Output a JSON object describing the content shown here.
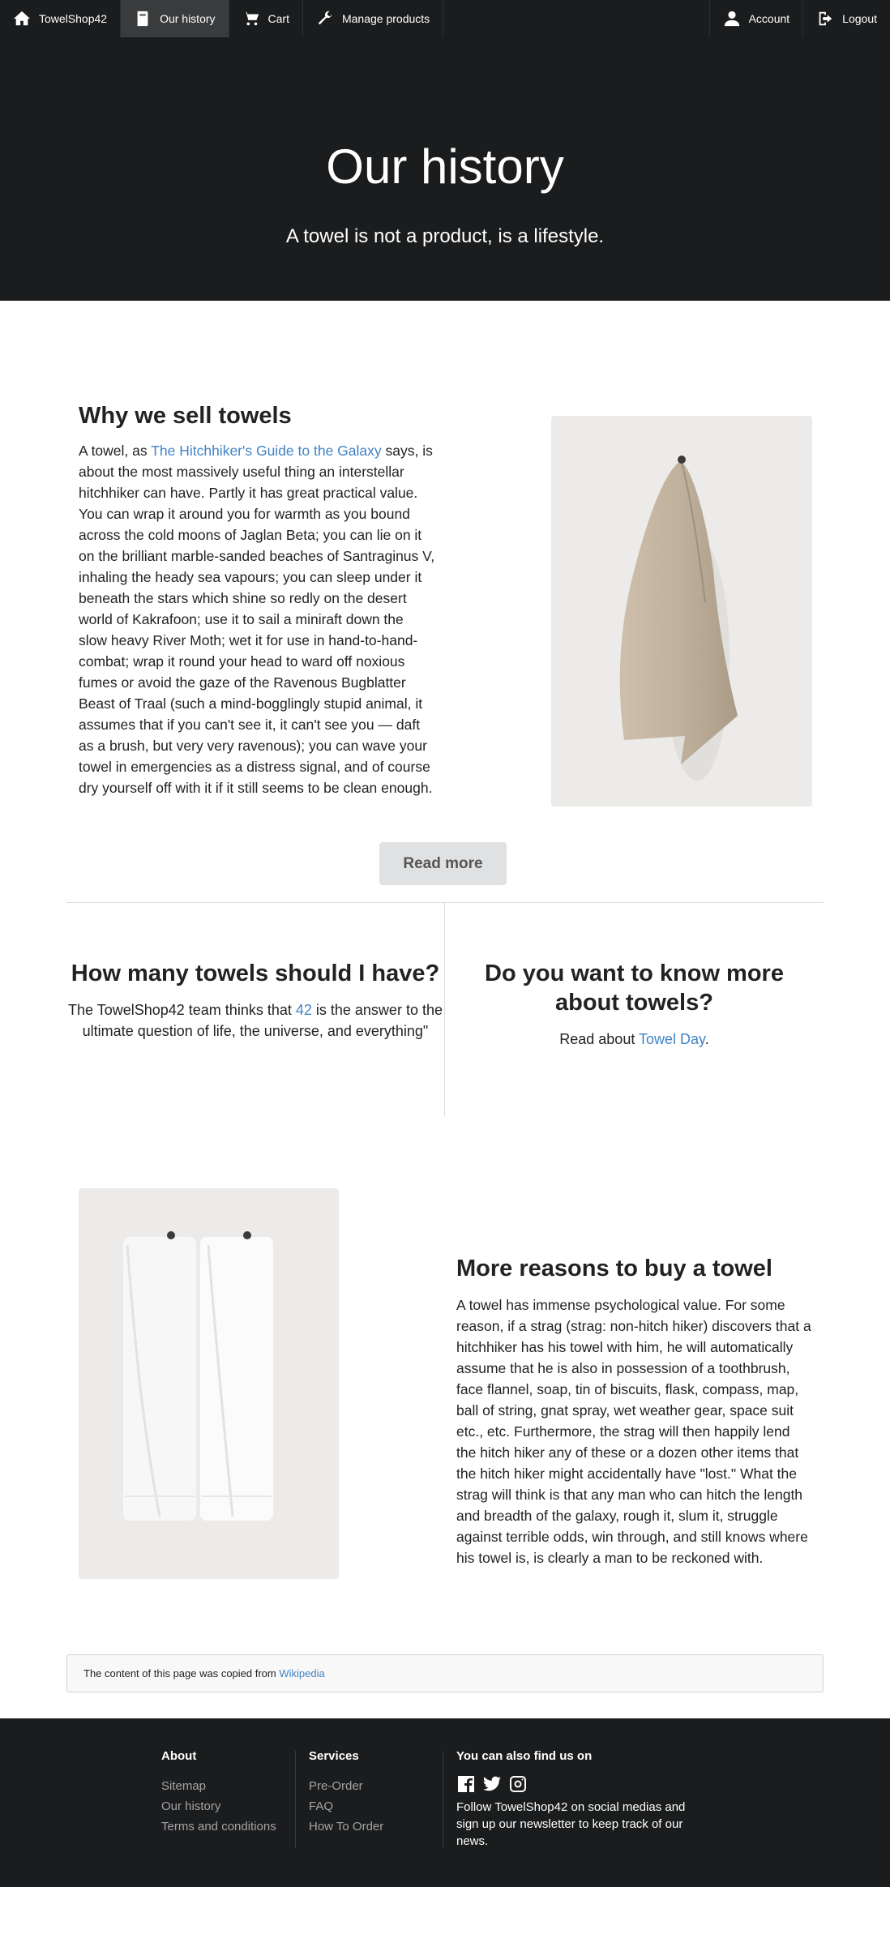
{
  "nav": {
    "brand": "TowelShop42",
    "history": "Our history",
    "cart": "Cart",
    "manage": "Manage products",
    "account": "Account",
    "logout": "Logout"
  },
  "hero": {
    "title": "Our history",
    "subtitle": "A towel is not a product, is a lifestyle."
  },
  "why": {
    "title": "Why we sell towels",
    "intro": "A towel, as ",
    "link": "The Hitchhiker's Guide to the Galaxy",
    "body": " says, is about the most massively useful thing an interstellar hitchhiker can have. Partly it has great practical value. You can wrap it around you for warmth as you bound across the cold moons of Jaglan Beta; you can lie on it on the brilliant marble-sanded beaches of Santraginus V, inhaling the heady sea vapours; you can sleep under it beneath the stars which shine so redly on the desert world of Kakrafoon; use it to sail a miniraft down the slow heavy River Moth; wet it for use in hand-to-hand-combat; wrap it round your head to ward off noxious fumes or avoid the gaze of the Ravenous Bugblatter Beast of Traal (such a mind-bogglingly stupid animal, it assumes that if you can't see it, it can't see you — daft as a brush, but very very ravenous); you can wave your towel in emergencies as a distress signal, and of course dry yourself off with it if it still seems to be clean enough.",
    "read_more": "Read more"
  },
  "how_many": {
    "title": "How many towels should I have?",
    "pre": "The TowelShop42 team thinks that ",
    "link": "42",
    "post": " is the answer to the ultimate question of life, the universe, and everything\""
  },
  "know_more": {
    "title": "Do you want to know more about towels?",
    "pre": "Read about ",
    "link": "Towel Day",
    "post": "."
  },
  "reasons": {
    "title": "More reasons to buy a towel",
    "body": "A towel has immense psychological value. For some reason, if a strag (strag: non-hitch hiker) discovers that a hitchhiker has his towel with him, he will automatically assume that he is also in possession of a toothbrush, face flannel, soap, tin of biscuits, flask, compass, map, ball of string, gnat spray, wet weather gear, space suit etc., etc. Furthermore, the strag will then happily lend the hitch hiker any of these or a dozen other items that the hitch hiker might accidentally have \"lost.\" What the strag will think is that any man who can hitch the length and breadth of the galaxy, rough it, slum it, struggle against terrible odds, win through, and still knows where his towel is, is clearly a man to be reckoned with."
  },
  "note": {
    "text": "The content of this page was copied from ",
    "link": "Wikipedia"
  },
  "footer": {
    "about": {
      "title": "About",
      "items": [
        "Sitemap",
        "Our history",
        "Terms and conditions"
      ]
    },
    "services": {
      "title": "Services",
      "items": [
        "Pre-Order",
        "FAQ",
        "How To Order"
      ]
    },
    "social": {
      "title": "You can also find us on",
      "icons": [
        "facebook-icon",
        "twitter-icon",
        "instagram-icon"
      ],
      "text": "Follow TowelShop42 on social medias and sign up our newsletter to keep track of our news."
    }
  },
  "colors": {
    "dark": "#1b1c1d",
    "link": "#4183c4",
    "button": "#e0e1e2"
  }
}
